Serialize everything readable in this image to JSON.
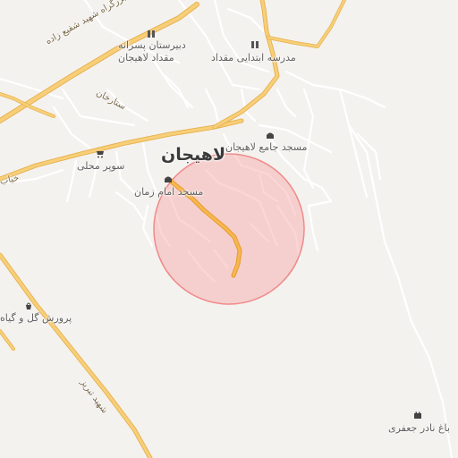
{
  "map": {
    "city_label": "لاهیجان",
    "roads": {
      "bozorgrah": "بزرگراه شهید شفیع زاده",
      "sattarkhan": "ستارخان",
      "khiaban": "خیاب",
      "tabriz": "شهید تبریز"
    },
    "places": {
      "dabirestan_line1": "دبیرستان پسرانه",
      "dabirestan_line2": "مقداد لاهیجان",
      "madreseh": "مدرسه ابتدایی مقداد",
      "masjed_jame": "مسجد جامع لاهیجان",
      "super_mahali": "سوپر محلی",
      "masjed_imam": "مسجد امام زمان",
      "parvaresh": "پرورش گل و گیاه",
      "bagh": "باغ نادر جعفری"
    },
    "colors": {
      "background": "#f4f2ef",
      "major_road": "#f5c96b",
      "minor_road": "#ffffff",
      "highlight_area": "#f7a3a3",
      "route": "#f0a030"
    }
  }
}
